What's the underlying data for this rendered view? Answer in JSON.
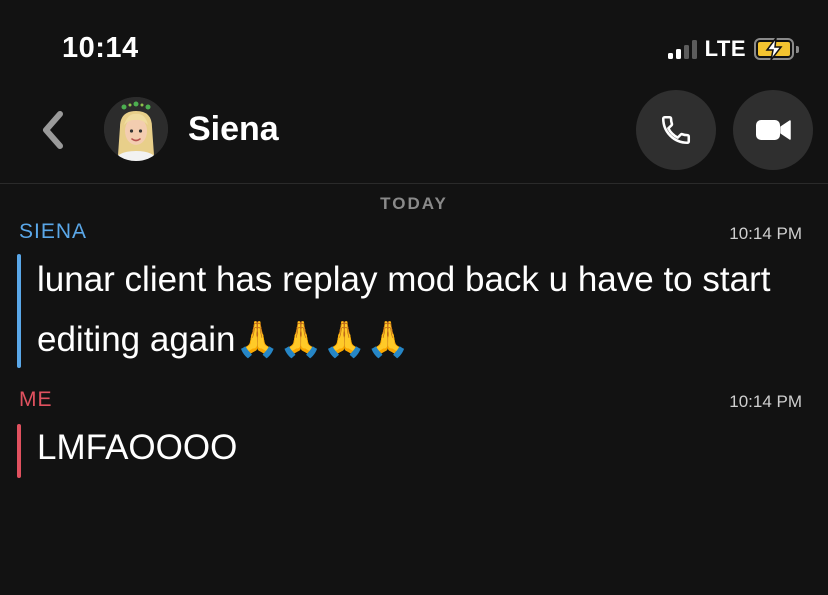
{
  "status_bar": {
    "time": "10:14",
    "network": "LTE",
    "signal_bars": 4,
    "signal_active": 2
  },
  "header": {
    "contact_name": "Siena"
  },
  "chat": {
    "day_label": "TODAY",
    "messages": [
      {
        "sender": "SIENA",
        "time": "10:14 PM",
        "text": "lunar client has replay mod back u have to start editing again🙏🙏🙏🙏"
      },
      {
        "sender": "ME",
        "time": "10:14 PM",
        "text": "LMFAOOOO"
      }
    ]
  },
  "colors": {
    "background": "#121212",
    "them": "#5aa7e8",
    "me": "#e0515f",
    "battery": "#f4c430"
  }
}
